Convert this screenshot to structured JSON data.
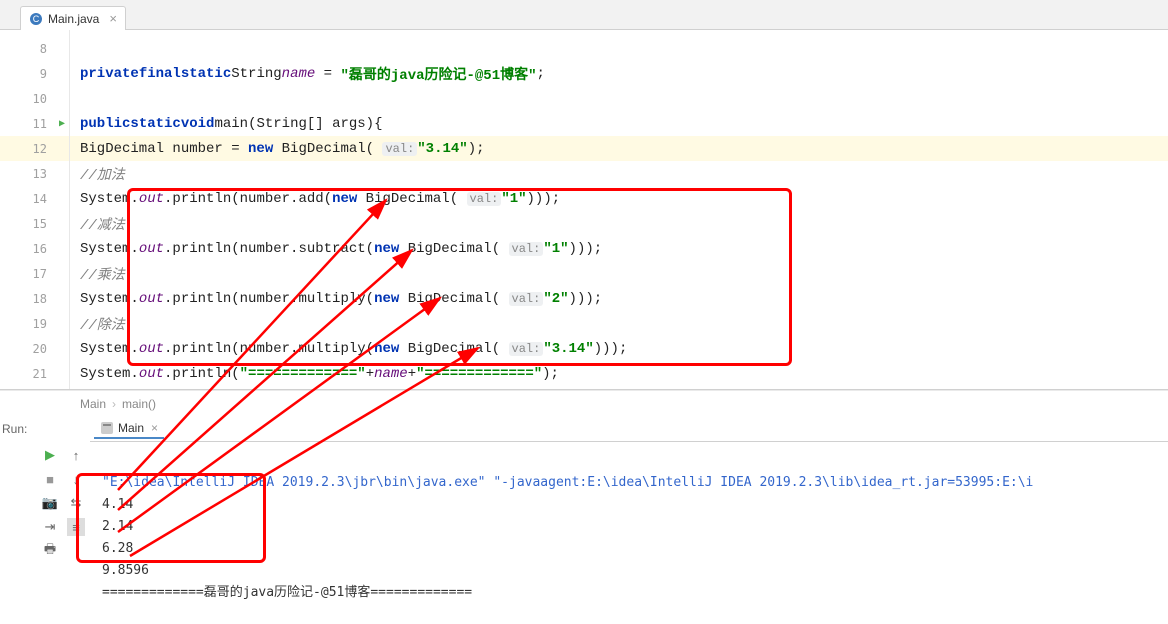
{
  "tab": {
    "filename": "Main.java"
  },
  "gutter": {
    "lines": [
      "8",
      "9",
      "10",
      "11",
      "12",
      "13",
      "14",
      "15",
      "16",
      "17",
      "18",
      "19",
      "20",
      "21"
    ],
    "highlight_line": "12",
    "run_marker_line": "11"
  },
  "code": {
    "l9": {
      "kw1": "private",
      "kw2": "final",
      "kw3": "static",
      "type": "String",
      "field": "name",
      "op": " = ",
      "str": "\"磊哥的java历险记-@51博客\"",
      "end": ";"
    },
    "l11": {
      "kw1": "public",
      "kw2": "static",
      "kw3": "void",
      "method": "main",
      "params": "(String[] args){"
    },
    "l12": {
      "lead": "BigDecimal number = ",
      "kw": "new",
      "cls": " BigDecimal( ",
      "hint": "val:",
      "str": "\"3.14\"",
      "end": ");"
    },
    "l13": {
      "cmt": "//加法"
    },
    "l14": {
      "pre": "System.",
      "out": "out",
      "mid": ".println(number.add(",
      "kw": "new",
      "cls": " BigDecimal( ",
      "hint": "val:",
      "str": "\"1\"",
      "end": ")));"
    },
    "l15": {
      "cmt": "//减法"
    },
    "l16": {
      "pre": "System.",
      "out": "out",
      "mid": ".println(number.subtract(",
      "kw": "new",
      "cls": " BigDecimal( ",
      "hint": "val:",
      "str": "\"1\"",
      "end": ")));"
    },
    "l17": {
      "cmt": "//乘法"
    },
    "l18": {
      "pre": "System.",
      "out": "out",
      "mid": ".println(number.multiply(",
      "kw": "new",
      "cls": " BigDecimal( ",
      "hint": "val:",
      "str": "\"2\"",
      "end": ")));"
    },
    "l19": {
      "cmt": "//除法"
    },
    "l20": {
      "pre": "System.",
      "out": "out",
      "mid": ".println(number.multiply(",
      "kw": "new",
      "cls": " BigDecimal( ",
      "hint": "val:",
      "str": "\"3.14\"",
      "end": ")));"
    },
    "l21": {
      "pre": "System.",
      "out": "out",
      "mid": ".println(",
      "str1": "\"=============\"",
      "plus1": "+",
      "field": "name",
      "plus2": "+",
      "str2": "\"=============\"",
      "end": ");"
    }
  },
  "breadcrumb": {
    "a": "Main",
    "b": "main()"
  },
  "run": {
    "label": "Run:",
    "tab": "Main",
    "cmd": "\"E:\\idea\\IntelliJ IDEA 2019.2.3\\jbr\\bin\\java.exe\" \"-javaagent:E:\\idea\\IntelliJ IDEA 2019.2.3\\lib\\idea_rt.jar=53995:E:\\i",
    "out1": "4.14",
    "out2": "2.14",
    "out3": "6.28",
    "out4": "9.8596",
    "out5": "=============磊哥的java历险记-@51博客============="
  }
}
